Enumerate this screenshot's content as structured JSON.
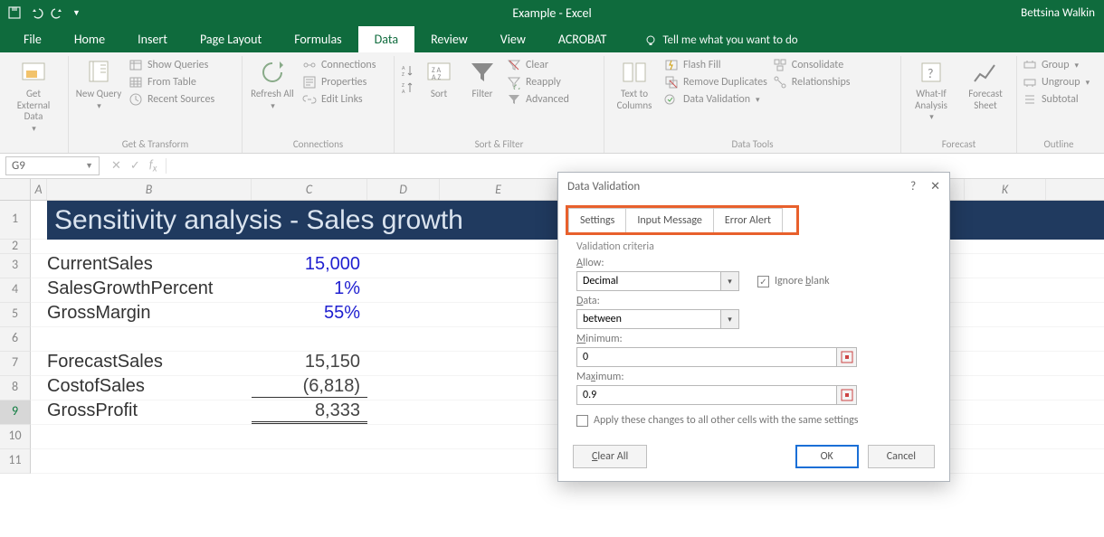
{
  "title": {
    "app": "Example - Excel",
    "user": "Bettsina Walkin"
  },
  "tabs": [
    "File",
    "Home",
    "Insert",
    "Page Layout",
    "Formulas",
    "Data",
    "Review",
    "View",
    "ACROBAT"
  ],
  "active_tab": "Data",
  "tellme": "Tell me what you want to do",
  "ribbon": {
    "get_external": "Get External Data",
    "new_query": "New Query",
    "show_queries": "Show Queries",
    "from_table": "From Table",
    "recent_sources": "Recent Sources",
    "group_get_transform": "Get & Transform",
    "refresh_all": "Refresh All",
    "connections": "Connections",
    "properties": "Properties",
    "edit_links": "Edit Links",
    "group_connections": "Connections",
    "sort": "Sort",
    "filter": "Filter",
    "clear": "Clear",
    "reapply": "Reapply",
    "advanced": "Advanced",
    "group_sort_filter": "Sort & Filter",
    "text_to_columns": "Text to Columns",
    "flash_fill": "Flash Fill",
    "remove_dup": "Remove Duplicates",
    "data_validation": "Data Validation",
    "consolidate": "Consolidate",
    "relationships": "Relationships",
    "group_data_tools": "Data Tools",
    "whatif": "What-If Analysis",
    "forecast_sheet": "Forecast Sheet",
    "group_forecast": "Forecast",
    "group": "Group",
    "ungroup": "Ungroup",
    "subtotal": "Subtotal",
    "group_outline": "Outline"
  },
  "namebox": "G9",
  "columns": [
    "A",
    "B",
    "C",
    "D",
    "E",
    "",
    "",
    "",
    "",
    "",
    "K"
  ],
  "sheet": {
    "banner": "Sensitivity analysis - Sales growth",
    "rows": [
      {
        "r": "3",
        "label": "CurrentSales",
        "val": "15,000",
        "cls": "blue"
      },
      {
        "r": "4",
        "label": "SalesGrowthPercent",
        "val": "1%",
        "cls": "blue"
      },
      {
        "r": "5",
        "label": "GrossMargin",
        "val": "55%",
        "cls": "blue"
      },
      {
        "r": "6",
        "label": "",
        "val": ""
      },
      {
        "r": "7",
        "label": "ForecastSales",
        "val": "15,150"
      },
      {
        "r": "8",
        "label": "CostofSales",
        "val": "(6,818)",
        "border": "underline1"
      },
      {
        "r": "9",
        "label": "GrossProfit",
        "val": "8,333",
        "border": "dbl"
      },
      {
        "r": "10",
        "label": "",
        "val": ""
      },
      {
        "r": "11",
        "label": "",
        "val": ""
      }
    ]
  },
  "dialog": {
    "title": "Data Validation",
    "help": "?",
    "close": "✕",
    "tabs": [
      "Settings",
      "Input Message",
      "Error Alert"
    ],
    "criteria_label": "Validation criteria",
    "allow_label": "Allow:",
    "allow_value": "Decimal",
    "ignore_blank": "Ignore blank",
    "data_label": "Data:",
    "data_value": "between",
    "min_label": "Minimum:",
    "min_value": "0",
    "max_label": "Maximum:",
    "max_value": "0.9",
    "apply_label": "Apply these changes to all other cells with the same settings",
    "clear_all": "Clear All",
    "ok": "OK",
    "cancel": "Cancel"
  }
}
